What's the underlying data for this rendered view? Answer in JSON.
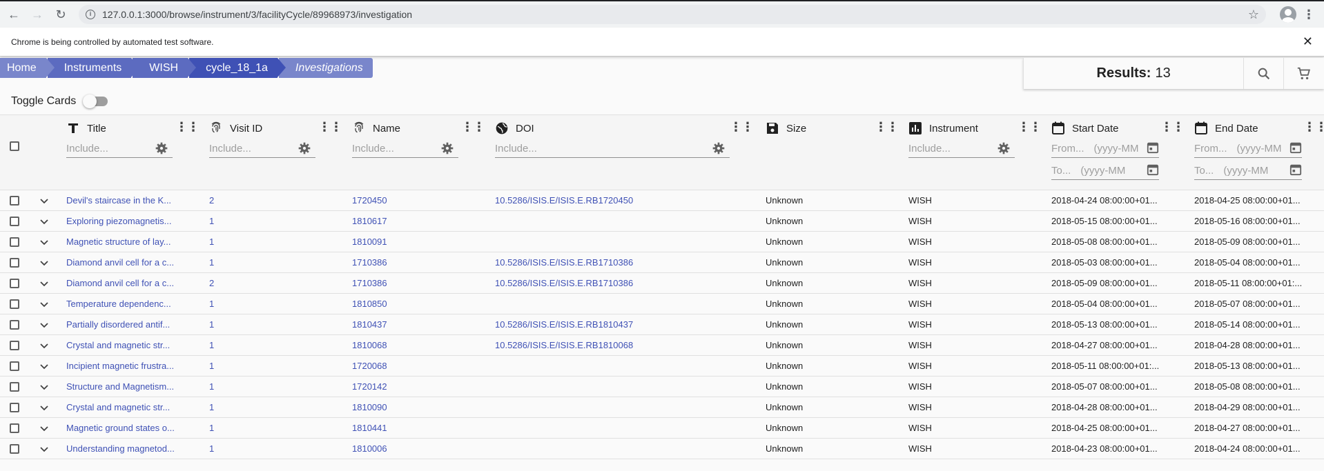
{
  "browser": {
    "url": "127.0.0.1:3000/browse/instrument/3/facilityCycle/89968973/investigation",
    "automation_notice": "Chrome is being controlled by automated test software."
  },
  "breadcrumbs": [
    {
      "label": "Home",
      "color": "#7986cb"
    },
    {
      "label": "Instruments",
      "color": "#5c6bc0"
    },
    {
      "label": "WISH",
      "color": "#5c6bc0"
    },
    {
      "label": "cycle_18_1a",
      "color": "#3f51b5"
    },
    {
      "label": "Investigations",
      "color": "#7986cb"
    }
  ],
  "results": {
    "label": "Results:",
    "count": "13"
  },
  "toggle": {
    "label": "Toggle Cards"
  },
  "columns": {
    "title": {
      "label": "Title",
      "placeholder": "Include..."
    },
    "visit_id": {
      "label": "Visit ID",
      "placeholder": "Include..."
    },
    "name": {
      "label": "Name",
      "placeholder": "Include..."
    },
    "doi": {
      "label": "DOI",
      "placeholder": "Include..."
    },
    "size": {
      "label": "Size"
    },
    "instrument": {
      "label": "Instrument",
      "placeholder": "Include..."
    },
    "start_date": {
      "label": "Start Date",
      "from": "From...",
      "to": "To...",
      "format": "(yyyy-MM"
    },
    "end_date": {
      "label": "End Date",
      "from": "From...",
      "to": "To...",
      "format": "(yyyy-MM"
    }
  },
  "rows": [
    {
      "title": "Devil's staircase in the K...",
      "visit": "2",
      "name": "1720450",
      "doi": "10.5286/ISIS.E/ISIS.E.RB1720450",
      "size": "Unknown",
      "instrument": "WISH",
      "start": "2018-04-24 08:00:00+01...",
      "end": "2018-04-25 08:00:00+01..."
    },
    {
      "title": "Exploring piezomagnetis...",
      "visit": "1",
      "name": "1810617",
      "doi": "",
      "size": "Unknown",
      "instrument": "WISH",
      "start": "2018-05-15 08:00:00+01...",
      "end": "2018-05-16 08:00:00+01..."
    },
    {
      "title": "Magnetic structure of lay...",
      "visit": "1",
      "name": "1810091",
      "doi": "",
      "size": "Unknown",
      "instrument": "WISH",
      "start": "2018-05-08 08:00:00+01...",
      "end": "2018-05-09 08:00:00+01..."
    },
    {
      "title": "Diamond anvil cell for a c...",
      "visit": "1",
      "name": "1710386",
      "doi": "10.5286/ISIS.E/ISIS.E.RB1710386",
      "size": "Unknown",
      "instrument": "WISH",
      "start": "2018-05-03 08:00:00+01...",
      "end": "2018-05-04 08:00:00+01..."
    },
    {
      "title": "Diamond anvil cell for a c...",
      "visit": "2",
      "name": "1710386",
      "doi": "10.5286/ISIS.E/ISIS.E.RB1710386",
      "size": "Unknown",
      "instrument": "WISH",
      "start": "2018-05-09 08:00:00+01...",
      "end": "2018-05-11 08:00:00+01:..."
    },
    {
      "title": "Temperature dependenc...",
      "visit": "1",
      "name": "1810850",
      "doi": "",
      "size": "Unknown",
      "instrument": "WISH",
      "start": "2018-05-04 08:00:00+01...",
      "end": "2018-05-07 08:00:00+01..."
    },
    {
      "title": "Partially disordered antif...",
      "visit": "1",
      "name": "1810437",
      "doi": "10.5286/ISIS.E/ISIS.E.RB1810437",
      "size": "Unknown",
      "instrument": "WISH",
      "start": "2018-05-13 08:00:00+01...",
      "end": "2018-05-14 08:00:00+01..."
    },
    {
      "title": "Crystal and magnetic str...",
      "visit": "1",
      "name": "1810068",
      "doi": "10.5286/ISIS.E/ISIS.E.RB1810068",
      "size": "Unknown",
      "instrument": "WISH",
      "start": "2018-04-27 08:00:00+01...",
      "end": "2018-04-28 08:00:00+01..."
    },
    {
      "title": "Incipient magnetic frustra...",
      "visit": "1",
      "name": "1720068",
      "doi": "",
      "size": "Unknown",
      "instrument": "WISH",
      "start": "2018-05-11 08:00:00+01:...",
      "end": "2018-05-13 08:00:00+01..."
    },
    {
      "title": "Structure and Magnetism...",
      "visit": "1",
      "name": "1720142",
      "doi": "",
      "size": "Unknown",
      "instrument": "WISH",
      "start": "2018-05-07 08:00:00+01...",
      "end": "2018-05-08 08:00:00+01..."
    },
    {
      "title": "Crystal and magnetic str...",
      "visit": "1",
      "name": "1810090",
      "doi": "",
      "size": "Unknown",
      "instrument": "WISH",
      "start": "2018-04-28 08:00:00+01...",
      "end": "2018-04-29 08:00:00+01..."
    },
    {
      "title": "Magnetic ground states o...",
      "visit": "1",
      "name": "1810441",
      "doi": "",
      "size": "Unknown",
      "instrument": "WISH",
      "start": "2018-04-25 08:00:00+01...",
      "end": "2018-04-27 08:00:00+01..."
    },
    {
      "title": "Understanding magnetod...",
      "visit": "1",
      "name": "1810006",
      "doi": "",
      "size": "Unknown",
      "instrument": "WISH",
      "start": "2018-04-23 08:00:00+01...",
      "end": "2018-04-24 08:00:00+01..."
    }
  ]
}
